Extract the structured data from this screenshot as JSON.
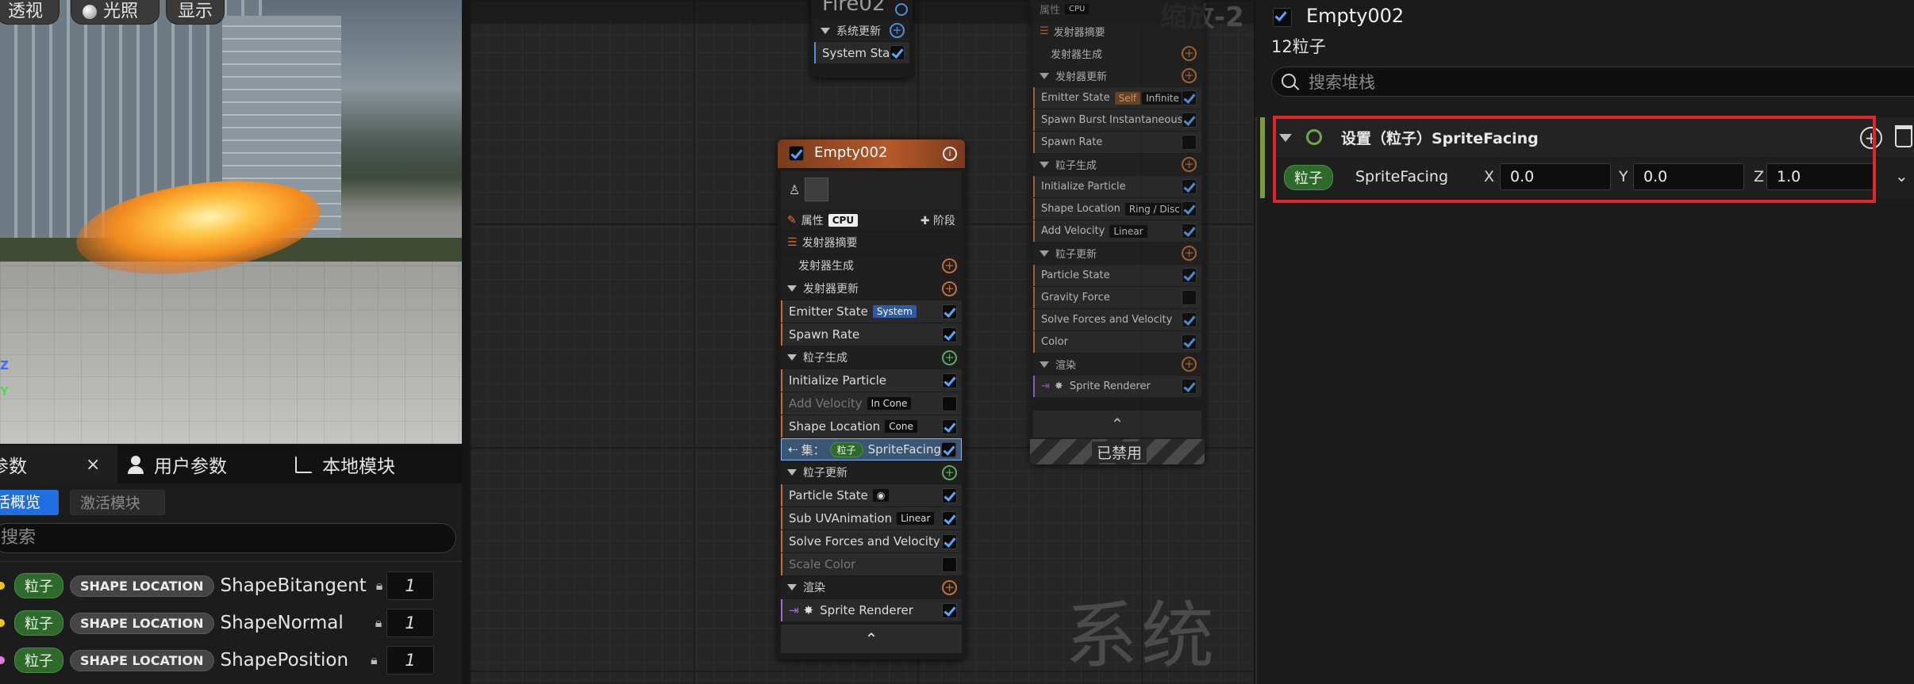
{
  "viewport": {
    "buttons": [
      "透视",
      "光照",
      "显示"
    ],
    "axes": {
      "z": "Z",
      "y": "Y"
    }
  },
  "left_panel": {
    "tabs": [
      {
        "label": "参数"
      },
      {
        "label": "用户参数"
      },
      {
        "label": "本地模块"
      }
    ],
    "close_glyph": "×",
    "subtabs": [
      {
        "label": "活概览"
      },
      {
        "label": "激活模块"
      }
    ],
    "search_placeholder": "搜索",
    "params": [
      {
        "dot": "#f0c419",
        "scope": "粒子",
        "module": "SHAPE LOCATION",
        "name": "ShapeBitangent",
        "value": "1"
      },
      {
        "dot": "#f0c419",
        "scope": "粒子",
        "module": "SHAPE LOCATION",
        "name": "ShapeNormal",
        "value": "1"
      },
      {
        "dot": "#e07be0",
        "scope": "粒子",
        "module": "SHAPE LOCATION",
        "name": "ShapePosition",
        "value": "1"
      }
    ]
  },
  "graph": {
    "watermark_system": "系统",
    "watermark_zoom": "缩放-2",
    "fire_node": {
      "title": "Fire02",
      "section": "系统更新",
      "row": "System State"
    },
    "empty_node": {
      "title": "Empty002",
      "props": "属性",
      "cpu": "CPU",
      "stage": "✚ 阶段",
      "rows": [
        {
          "t": "sec",
          "label": "发射器摘要"
        },
        {
          "t": "sub",
          "label": "发射器生成"
        },
        {
          "t": "sec",
          "label": "发射器更新"
        },
        {
          "t": "row",
          "label": "Emitter State",
          "tag": "System",
          "check": true
        },
        {
          "t": "row",
          "label": "Spawn Rate",
          "check": true
        },
        {
          "t": "sec",
          "label": "粒子生成",
          "green": true
        },
        {
          "t": "row",
          "label": "Initialize Particle",
          "check": true
        },
        {
          "t": "row",
          "label": "Add Velocity",
          "tag": "In Cone",
          "check": false,
          "dim": true
        },
        {
          "t": "row",
          "label": "Shape Location",
          "tag": "Cone",
          "check": true
        },
        {
          "t": "sel",
          "label": "集：",
          "pill": "粒子",
          "name": "SpriteFacing",
          "check": true
        },
        {
          "t": "sec",
          "label": "粒子更新",
          "green": true
        },
        {
          "t": "row",
          "label": "Particle State",
          "tag": "◉",
          "check": true
        },
        {
          "t": "row",
          "label": "Sub UVAnimation",
          "tag": "Linear",
          "check": true
        },
        {
          "t": "row",
          "label": "Solve Forces and Velocity",
          "check": true
        },
        {
          "t": "row",
          "label": "Scale Color",
          "check": false,
          "dim": true
        },
        {
          "t": "sec",
          "label": "渲染"
        },
        {
          "t": "row",
          "label": "Sprite Renderer",
          "check": true
        }
      ],
      "collapse_glyph": "⌃"
    },
    "right_node": {
      "top": "属性",
      "cpu": "CPU",
      "rows": [
        {
          "t": "sec",
          "label": "发射器摘要"
        },
        {
          "t": "sub",
          "label": "发射器生成"
        },
        {
          "t": "sec",
          "label": "发射器更新"
        },
        {
          "t": "row",
          "label": "Emitter State",
          "tag": "Self",
          "tag2": "Infinite",
          "check": true
        },
        {
          "t": "row",
          "label": "Spawn Burst Instantaneous",
          "check": true
        },
        {
          "t": "row",
          "label": "Spawn Rate",
          "check": false
        },
        {
          "t": "sec",
          "label": "粒子生成"
        },
        {
          "t": "row",
          "label": "Initialize Particle",
          "check": true
        },
        {
          "t": "row",
          "label": "Shape Location",
          "tag": "Ring / Disc",
          "check": true
        },
        {
          "t": "row",
          "label": "Add Velocity",
          "tag": "Linear",
          "check": true
        },
        {
          "t": "sec",
          "label": "粒子更新"
        },
        {
          "t": "row",
          "label": "Particle State",
          "check": true
        },
        {
          "t": "row",
          "label": "Gravity Force",
          "check": false
        },
        {
          "t": "row",
          "label": "Solve Forces and Velocity",
          "check": true
        },
        {
          "t": "row",
          "label": "Color",
          "check": true
        },
        {
          "t": "sec",
          "label": "渲染"
        },
        {
          "t": "row",
          "label": "Sprite Renderer",
          "check": true
        }
      ],
      "collapse_glyph": "⌃",
      "disabled": "已禁用"
    }
  },
  "right_panel": {
    "title": "Empty002",
    "count": "12粒子",
    "search_placeholder": "搜索堆栈",
    "module_title": "设置（粒子）SpriteFacing",
    "pill": "粒子",
    "param": "SpriteFacing",
    "x_label": "X",
    "x": "0.0",
    "y_label": "Y",
    "y": "0.0",
    "z_label": "Z",
    "z": "1.0",
    "highlight_color": "#e0262b"
  }
}
